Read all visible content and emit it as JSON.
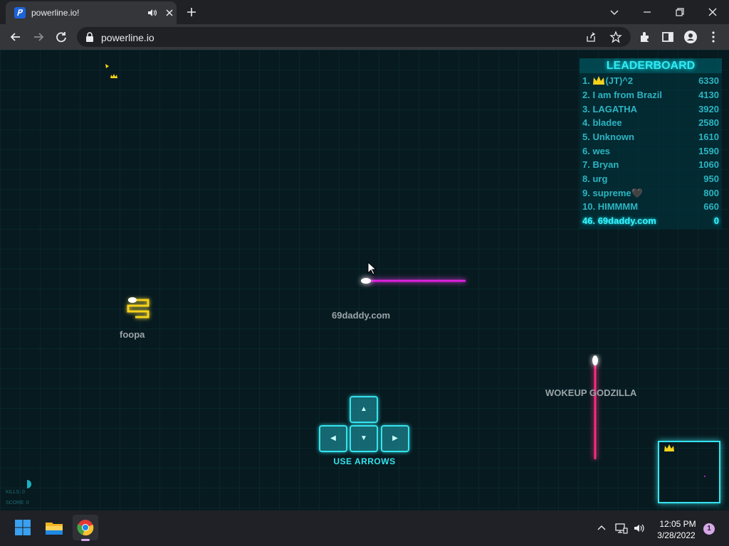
{
  "browser": {
    "tab_title": "powerline.io!",
    "url": "powerline.io"
  },
  "leaderboard": {
    "title": "LEADERBOARD",
    "rows": [
      {
        "rank": "1.",
        "name": "(JT)^2",
        "score": "6330",
        "crown": true
      },
      {
        "rank": "2.",
        "name": "I am from Brazil",
        "score": "4130"
      },
      {
        "rank": "3.",
        "name": "LAGATHA",
        "score": "3920"
      },
      {
        "rank": "4.",
        "name": "bladee",
        "score": "2580"
      },
      {
        "rank": "5.",
        "name": "Unknown",
        "score": "1610"
      },
      {
        "rank": "6.",
        "name": "wes",
        "score": "1590"
      },
      {
        "rank": "7.",
        "name": "Bryan",
        "score": "1060"
      },
      {
        "rank": "8.",
        "name": "urg",
        "score": "950"
      },
      {
        "rank": "9.",
        "name": "supreme🖤",
        "score": "800"
      },
      {
        "rank": "10.",
        "name": "HIMMMM",
        "score": "660"
      }
    ],
    "self": {
      "rank": "46.",
      "name": "69daddy.com",
      "score": "0"
    }
  },
  "players": {
    "self": "69daddy.com",
    "foopa": "foopa",
    "godzilla": "WOKEUP GODZILLA"
  },
  "controls": {
    "hint": "USE ARROWS",
    "up": "▲",
    "left": "◀",
    "down": "▼",
    "right": "▶"
  },
  "stats": {
    "kills": "KILLS: 0",
    "score": "SCORE: 0"
  },
  "taskbar": {
    "time": "12:05 PM",
    "date": "3/28/2022",
    "notifications": "1"
  },
  "colors": {
    "accent": "#36e3ee",
    "self_snake": "#e020e0",
    "godzilla_snake": "#ff2a7a",
    "foopa_snake": "#f5d21a"
  }
}
